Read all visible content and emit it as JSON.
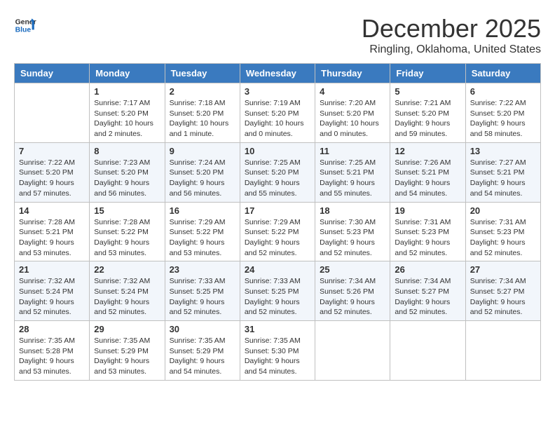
{
  "header": {
    "logo_general": "General",
    "logo_blue": "Blue",
    "month": "December 2025",
    "location": "Ringling, Oklahoma, United States"
  },
  "days_of_week": [
    "Sunday",
    "Monday",
    "Tuesday",
    "Wednesday",
    "Thursday",
    "Friday",
    "Saturday"
  ],
  "weeks": [
    [
      {
        "day": "",
        "info": ""
      },
      {
        "day": "1",
        "info": "Sunrise: 7:17 AM\nSunset: 5:20 PM\nDaylight: 10 hours\nand 2 minutes."
      },
      {
        "day": "2",
        "info": "Sunrise: 7:18 AM\nSunset: 5:20 PM\nDaylight: 10 hours\nand 1 minute."
      },
      {
        "day": "3",
        "info": "Sunrise: 7:19 AM\nSunset: 5:20 PM\nDaylight: 10 hours\nand 0 minutes."
      },
      {
        "day": "4",
        "info": "Sunrise: 7:20 AM\nSunset: 5:20 PM\nDaylight: 10 hours\nand 0 minutes."
      },
      {
        "day": "5",
        "info": "Sunrise: 7:21 AM\nSunset: 5:20 PM\nDaylight: 9 hours\nand 59 minutes."
      },
      {
        "day": "6",
        "info": "Sunrise: 7:22 AM\nSunset: 5:20 PM\nDaylight: 9 hours\nand 58 minutes."
      }
    ],
    [
      {
        "day": "7",
        "info": "Sunrise: 7:22 AM\nSunset: 5:20 PM\nDaylight: 9 hours\nand 57 minutes."
      },
      {
        "day": "8",
        "info": "Sunrise: 7:23 AM\nSunset: 5:20 PM\nDaylight: 9 hours\nand 56 minutes."
      },
      {
        "day": "9",
        "info": "Sunrise: 7:24 AM\nSunset: 5:20 PM\nDaylight: 9 hours\nand 56 minutes."
      },
      {
        "day": "10",
        "info": "Sunrise: 7:25 AM\nSunset: 5:20 PM\nDaylight: 9 hours\nand 55 minutes."
      },
      {
        "day": "11",
        "info": "Sunrise: 7:25 AM\nSunset: 5:21 PM\nDaylight: 9 hours\nand 55 minutes."
      },
      {
        "day": "12",
        "info": "Sunrise: 7:26 AM\nSunset: 5:21 PM\nDaylight: 9 hours\nand 54 minutes."
      },
      {
        "day": "13",
        "info": "Sunrise: 7:27 AM\nSunset: 5:21 PM\nDaylight: 9 hours\nand 54 minutes."
      }
    ],
    [
      {
        "day": "14",
        "info": "Sunrise: 7:28 AM\nSunset: 5:21 PM\nDaylight: 9 hours\nand 53 minutes."
      },
      {
        "day": "15",
        "info": "Sunrise: 7:28 AM\nSunset: 5:22 PM\nDaylight: 9 hours\nand 53 minutes."
      },
      {
        "day": "16",
        "info": "Sunrise: 7:29 AM\nSunset: 5:22 PM\nDaylight: 9 hours\nand 53 minutes."
      },
      {
        "day": "17",
        "info": "Sunrise: 7:29 AM\nSunset: 5:22 PM\nDaylight: 9 hours\nand 52 minutes."
      },
      {
        "day": "18",
        "info": "Sunrise: 7:30 AM\nSunset: 5:23 PM\nDaylight: 9 hours\nand 52 minutes."
      },
      {
        "day": "19",
        "info": "Sunrise: 7:31 AM\nSunset: 5:23 PM\nDaylight: 9 hours\nand 52 minutes."
      },
      {
        "day": "20",
        "info": "Sunrise: 7:31 AM\nSunset: 5:23 PM\nDaylight: 9 hours\nand 52 minutes."
      }
    ],
    [
      {
        "day": "21",
        "info": "Sunrise: 7:32 AM\nSunset: 5:24 PM\nDaylight: 9 hours\nand 52 minutes."
      },
      {
        "day": "22",
        "info": "Sunrise: 7:32 AM\nSunset: 5:24 PM\nDaylight: 9 hours\nand 52 minutes."
      },
      {
        "day": "23",
        "info": "Sunrise: 7:33 AM\nSunset: 5:25 PM\nDaylight: 9 hours\nand 52 minutes."
      },
      {
        "day": "24",
        "info": "Sunrise: 7:33 AM\nSunset: 5:25 PM\nDaylight: 9 hours\nand 52 minutes."
      },
      {
        "day": "25",
        "info": "Sunrise: 7:34 AM\nSunset: 5:26 PM\nDaylight: 9 hours\nand 52 minutes."
      },
      {
        "day": "26",
        "info": "Sunrise: 7:34 AM\nSunset: 5:27 PM\nDaylight: 9 hours\nand 52 minutes."
      },
      {
        "day": "27",
        "info": "Sunrise: 7:34 AM\nSunset: 5:27 PM\nDaylight: 9 hours\nand 52 minutes."
      }
    ],
    [
      {
        "day": "28",
        "info": "Sunrise: 7:35 AM\nSunset: 5:28 PM\nDaylight: 9 hours\nand 53 minutes."
      },
      {
        "day": "29",
        "info": "Sunrise: 7:35 AM\nSunset: 5:29 PM\nDaylight: 9 hours\nand 53 minutes."
      },
      {
        "day": "30",
        "info": "Sunrise: 7:35 AM\nSunset: 5:29 PM\nDaylight: 9 hours\nand 54 minutes."
      },
      {
        "day": "31",
        "info": "Sunrise: 7:35 AM\nSunset: 5:30 PM\nDaylight: 9 hours\nand 54 minutes."
      },
      {
        "day": "",
        "info": ""
      },
      {
        "day": "",
        "info": ""
      },
      {
        "day": "",
        "info": ""
      }
    ]
  ]
}
